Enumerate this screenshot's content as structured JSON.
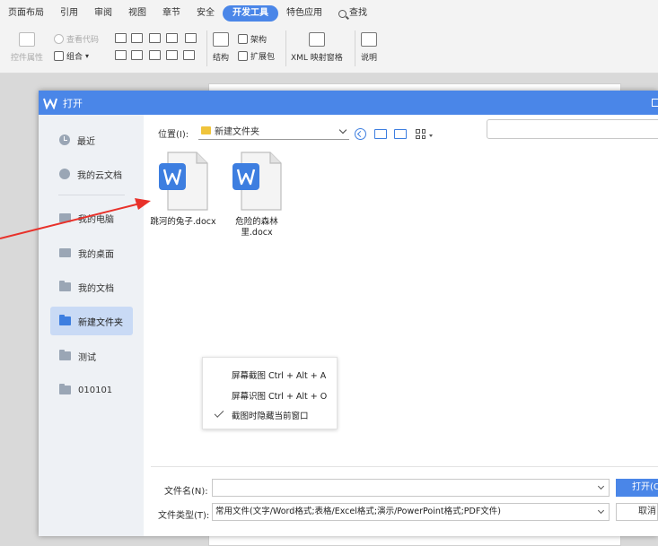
{
  "ribbon": {
    "tabs": [
      "页面布局",
      "引用",
      "审阅",
      "视图",
      "章节",
      "安全",
      "开发工具",
      "特色应用",
      "查找"
    ],
    "active_tab": "开发工具",
    "tools": {
      "control_props": "控件属性",
      "view_code": "查看代码",
      "group": "组合",
      "structure": "结构",
      "architecture": "架构",
      "extension": "扩展包",
      "xml_mapping": "XML 映射窗格",
      "help": "说明"
    }
  },
  "dialog": {
    "title": "打开",
    "accent": "#4a86e8",
    "sidebar": [
      {
        "label": "最近",
        "icon": "clock-icon"
      },
      {
        "label": "我的云文档",
        "icon": "cloud-icon"
      },
      {
        "label": "我的电脑",
        "icon": "computer-icon"
      },
      {
        "label": "我的桌面",
        "icon": "desktop-icon"
      },
      {
        "label": "我的文档",
        "icon": "folder-icon"
      },
      {
        "label": "新建文件夹",
        "icon": "folder-icon",
        "active": true
      },
      {
        "label": "测试",
        "icon": "folder-icon"
      },
      {
        "label": "010101",
        "icon": "folder-icon"
      }
    ],
    "location_label": "位置(I):",
    "location_value": "新建文件夹",
    "files": [
      {
        "name": "跳河的兔子.docx"
      },
      {
        "name": "危险的森林里.docx"
      }
    ],
    "filename_label": "文件名(N):",
    "filename_value": "",
    "filetype_label": "文件类型(T):",
    "filetype_value": "常用文件(文字/Word格式;表格/Excel格式;演示/PowerPoint格式;PDF文件)",
    "open_button": "打开(O)",
    "cancel_button": "取消"
  },
  "context_menu": {
    "items": [
      {
        "label": "屏幕截图 Ctrl + Alt + A",
        "checked": false
      },
      {
        "label": "屏幕识图 Ctrl + Alt + O",
        "checked": false
      },
      {
        "label": "截图时隐藏当前窗口",
        "checked": true
      }
    ]
  }
}
